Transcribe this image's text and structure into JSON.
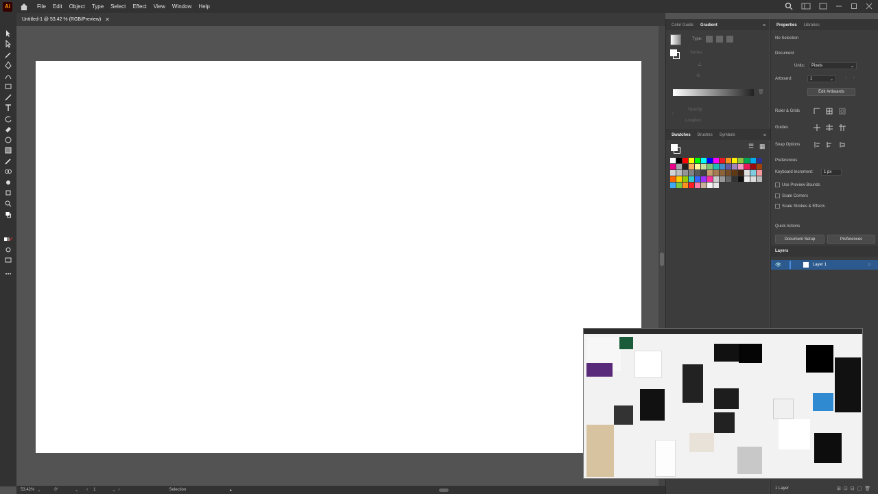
{
  "app": {
    "logo": "Ai"
  },
  "menu": [
    "File",
    "Edit",
    "Object",
    "Type",
    "Select",
    "Effect",
    "View",
    "Window",
    "Help"
  ],
  "document_tab": {
    "title": "Untitled-1 @ 53.42 % (RGB/Preview)",
    "close": "✕"
  },
  "statusbar": {
    "zoom": "53.42%",
    "rotation": "0°",
    "artboard": "1",
    "tool": "Selection"
  },
  "gradient_panel": {
    "tabs": [
      "Color Guide",
      "Gradient"
    ],
    "active_tab": "Gradient",
    "type_label": "Type:",
    "stroke_label": "Stroke:",
    "opacity_label": "Opacity:",
    "location_label": "Location:"
  },
  "swatches_panel": {
    "tabs": [
      "Swatches",
      "Brushes",
      "Symbols"
    ],
    "active_tab": "Swatches"
  },
  "properties": {
    "tabs": [
      "Properties",
      "Libraries"
    ],
    "active_tab": "Properties",
    "selection": "No Selection",
    "document_heading": "Document",
    "units_label": "Units:",
    "units_value": "Pixels",
    "artboard_label": "Artboard:",
    "artboard_value": "1",
    "edit_artboards": "Edit Artboards",
    "ruler_grids": "Ruler & Grids",
    "guides": "Guides",
    "snap_options": "Snap Options",
    "preferences_heading": "Preferences",
    "keyboard_increment_label": "Keyboard Increment:",
    "keyboard_increment_value": "1 px",
    "use_preview_bounds": "Use Preview Bounds",
    "scale_corners": "Scale Corners",
    "scale_strokes": "Scale Strokes & Effects",
    "quick_actions": "Quick Actions",
    "document_setup": "Document Setup",
    "preferences_button": "Preferences"
  },
  "layers": {
    "heading": "Layers",
    "layer_name": "Layer 1",
    "footer_count": "1 Layer"
  },
  "colors": {
    "menubar": "#323232",
    "pasteboard": "#535353",
    "panel": "#3c3c3c",
    "selected_layer": "#2c5a8e",
    "artboard": "#ffffff"
  }
}
